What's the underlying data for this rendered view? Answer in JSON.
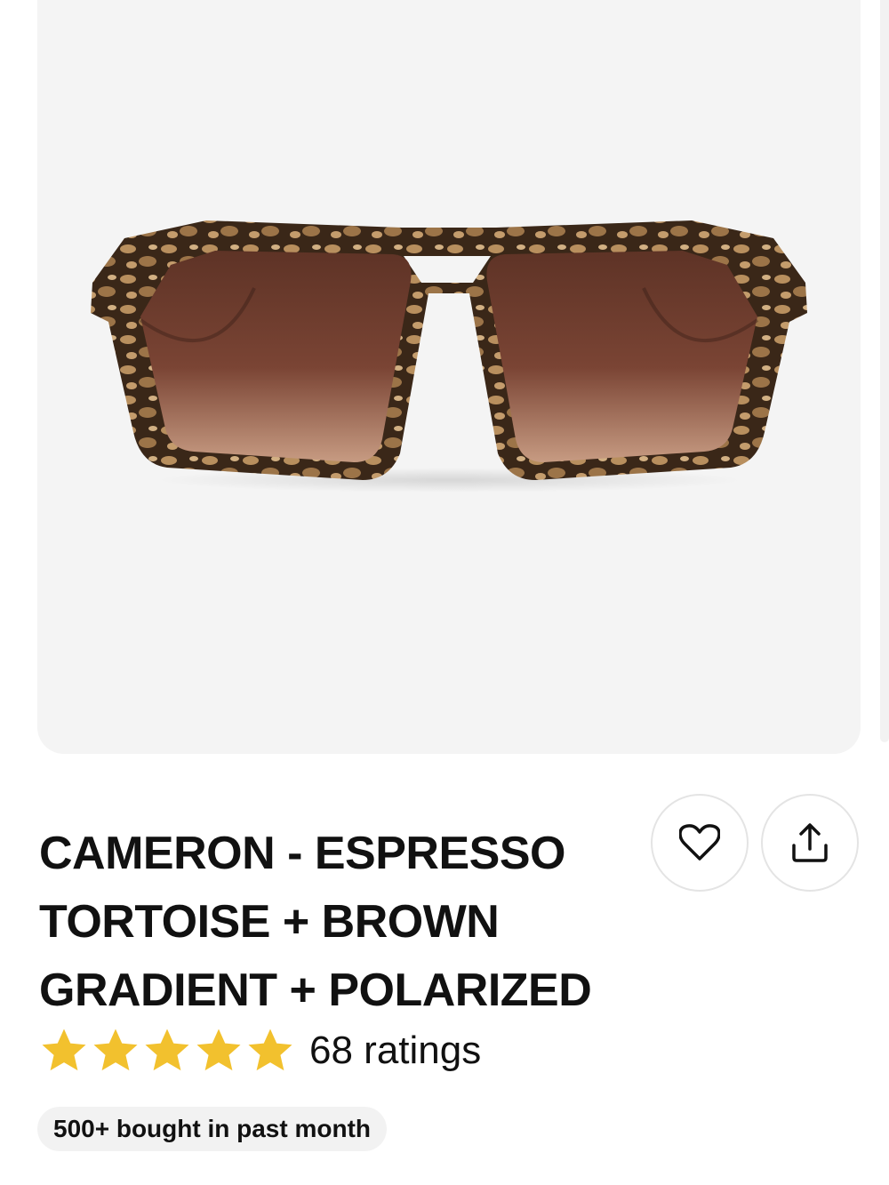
{
  "product": {
    "title_lines": [
      "CAMERON - ESPRESSO",
      "TORTOISE + BROWN",
      "GRADIENT + POLARIZED"
    ],
    "rating_value": 5,
    "rating_max": 5,
    "ratings_label": "68 ratings",
    "badge": "500+ bought in past month"
  },
  "actions": {
    "favorite_icon": "heart-icon",
    "share_icon": "share-icon"
  },
  "image": {
    "subject": "sunglasses-icon"
  },
  "colors": {
    "star": "#F2C12E",
    "card_bg": "#F4F4F4",
    "lens": "#7A4434"
  }
}
